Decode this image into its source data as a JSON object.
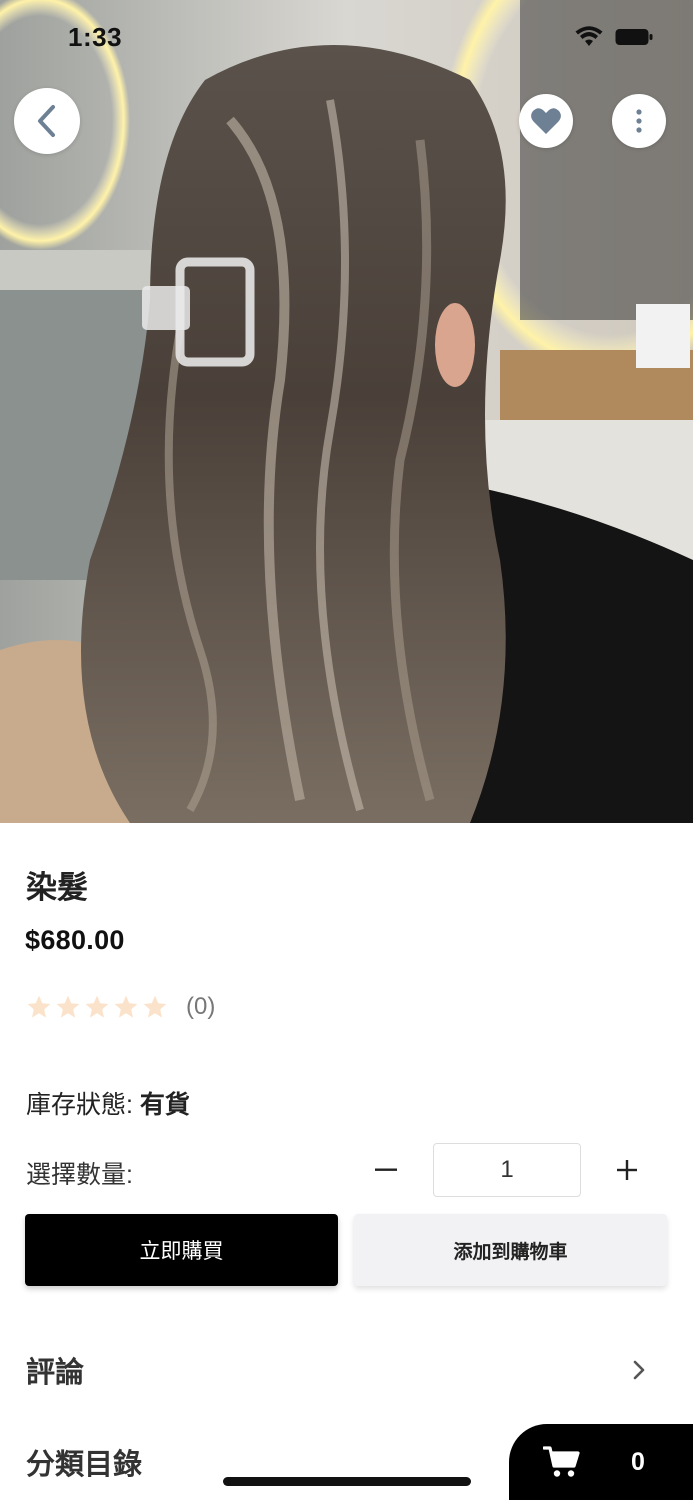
{
  "status_bar": {
    "time": "1:33"
  },
  "product": {
    "title": "染髮",
    "price": "$680.00",
    "rating_count": "(0)",
    "rating_value": 0,
    "rating_max": 5,
    "stock_label": "庫存狀態:",
    "stock_value": "有貨",
    "quantity_label": "選擇數量:",
    "quantity": "1"
  },
  "actions": {
    "buy_now": "立即購買",
    "add_to_cart": "添加到購物車"
  },
  "sections": {
    "reviews": "評論",
    "categories": "分類目錄"
  },
  "cart": {
    "count": "0"
  },
  "icons": {
    "back": "chevron-left-icon",
    "favorite": "heart-icon",
    "more": "more-vertical-icon",
    "reviews_arrow": "chevron-right-icon",
    "cart": "shopping-cart-icon"
  },
  "colors": {
    "primary_button": "#000000",
    "secondary_button": "#f2f2f4",
    "star_empty": "#fbe3cb",
    "icon_accent": "#6d8094"
  }
}
